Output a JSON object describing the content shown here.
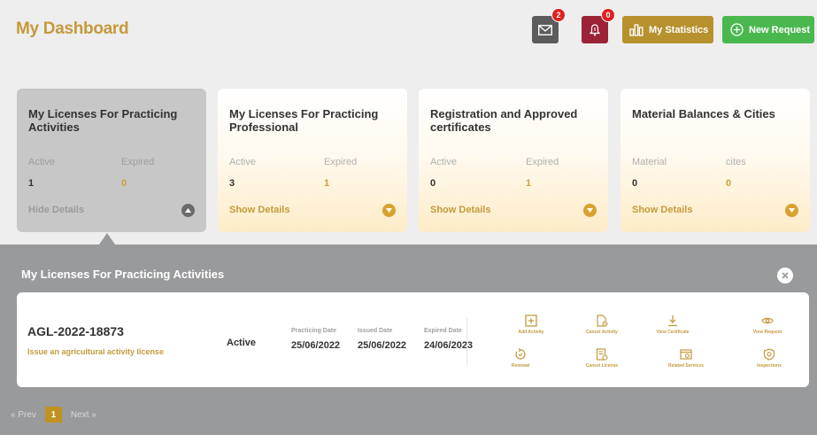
{
  "header": {
    "title": "My Dashboard",
    "mail_badge": "2",
    "bell_badge": "0",
    "statistics_label": "My Statistics",
    "new_request_label": "New Request"
  },
  "cards": [
    {
      "title": "My Licenses For Practicing Activities",
      "label1": "Active",
      "value1": "1",
      "label2": "Expired",
      "value2": "0",
      "link": "Hide Details"
    },
    {
      "title": "My Licenses For Practicing Professional",
      "label1": "Active",
      "value1": "3",
      "label2": "Expired",
      "value2": "1",
      "link": "Show Details"
    },
    {
      "title": "Registration and Approved certificates",
      "label1": "Active",
      "value1": "0",
      "label2": "Expired",
      "value2": "1",
      "link": "Show Details"
    },
    {
      "title": "Material Balances & Cities",
      "label1": "Material",
      "value1": "0",
      "label2": "cites",
      "value2": "0",
      "link": "Show Details"
    }
  ],
  "panel": {
    "title": "My Licenses For Practicing Activities",
    "license": {
      "number": "AGL-2022-18873",
      "description": "Issue an agricultural activity license",
      "status": "Active",
      "practicing_date_label": "Practicing Date",
      "practicing_date": "25/06/2022",
      "issued_date_label": "Issued Date",
      "issued_date": "25/06/2022",
      "expired_date_label": "Expired Date",
      "expired_date": "24/06/2023"
    },
    "actions": [
      {
        "label": "Add Activity",
        "icon": "add-box-icon"
      },
      {
        "label": "Cancel Activity",
        "icon": "cancel-doc-icon"
      },
      {
        "label": "View Certificate",
        "icon": "download-icon"
      },
      {
        "label": "View Request",
        "icon": "eye-icon"
      },
      {
        "label": "Renewal",
        "icon": "renew-icon"
      },
      {
        "label": "Cancel License",
        "icon": "cancel-license-icon"
      },
      {
        "label": "Related Services",
        "icon": "related-services-icon"
      },
      {
        "label": "Inspections",
        "icon": "shield-icon"
      }
    ],
    "pagination": {
      "prev": "Prev",
      "current": "1",
      "next": "Next"
    }
  },
  "colors": {
    "gold": "#c49a3c",
    "green": "#4bb84f",
    "maroon": "#9c2236",
    "panel_gray": "#999a9c"
  }
}
